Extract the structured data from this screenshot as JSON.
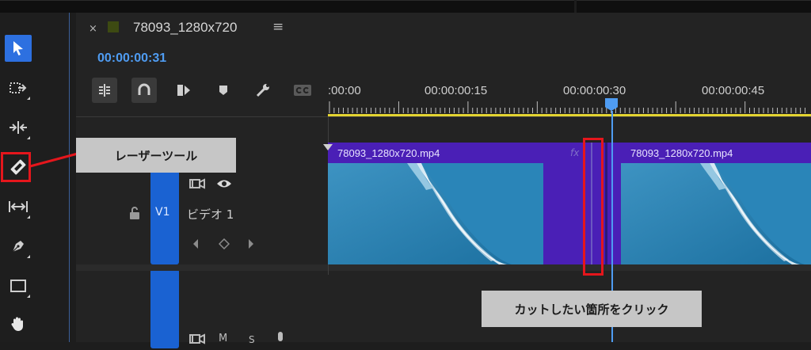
{
  "panel": {
    "tab_close": "×",
    "sequence_name": "78093_1280x720",
    "tab_menu": "≡",
    "timecode": "00:00:00:31"
  },
  "toolbar_icons": [
    "insert-snap-icon",
    "magnet-icon",
    "linked-selection-icon",
    "marker-icon",
    "wrench-icon",
    "captions-icon"
  ],
  "tools": [
    "selection-tool-icon",
    "track-select-forward-icon",
    "ripple-edit-icon",
    "razor-tool-icon",
    "slip-tool-icon",
    "pen-tool-icon",
    "rectangle-tool-icon",
    "hand-tool-icon"
  ],
  "ruler": {
    "labels": [
      ":00:00",
      "00:00:00:15",
      "00:00:00:30",
      "00:00:00:45"
    ]
  },
  "tracks": {
    "v1": {
      "label": "V1",
      "name": "ビデオ 1"
    },
    "audio": {
      "mute_label": "M",
      "solo_label": "S"
    }
  },
  "clips": [
    {
      "name": "78093_1280x720.mp4",
      "fx": "fx"
    },
    {
      "name": "78093_1280x720.mp4"
    }
  ],
  "annotations": {
    "razor_callout": "レーザーツール",
    "cut_callout": "カットしたい箇所をクリック"
  },
  "colors": {
    "accent_blue": "#2d70e0",
    "timecode_blue": "#4f9cf2",
    "clip_purple": "#4a1fb6",
    "track_target_blue": "#1a62d2",
    "work_area_yellow": "#e4d431",
    "annotation_red": "#e5161c"
  }
}
